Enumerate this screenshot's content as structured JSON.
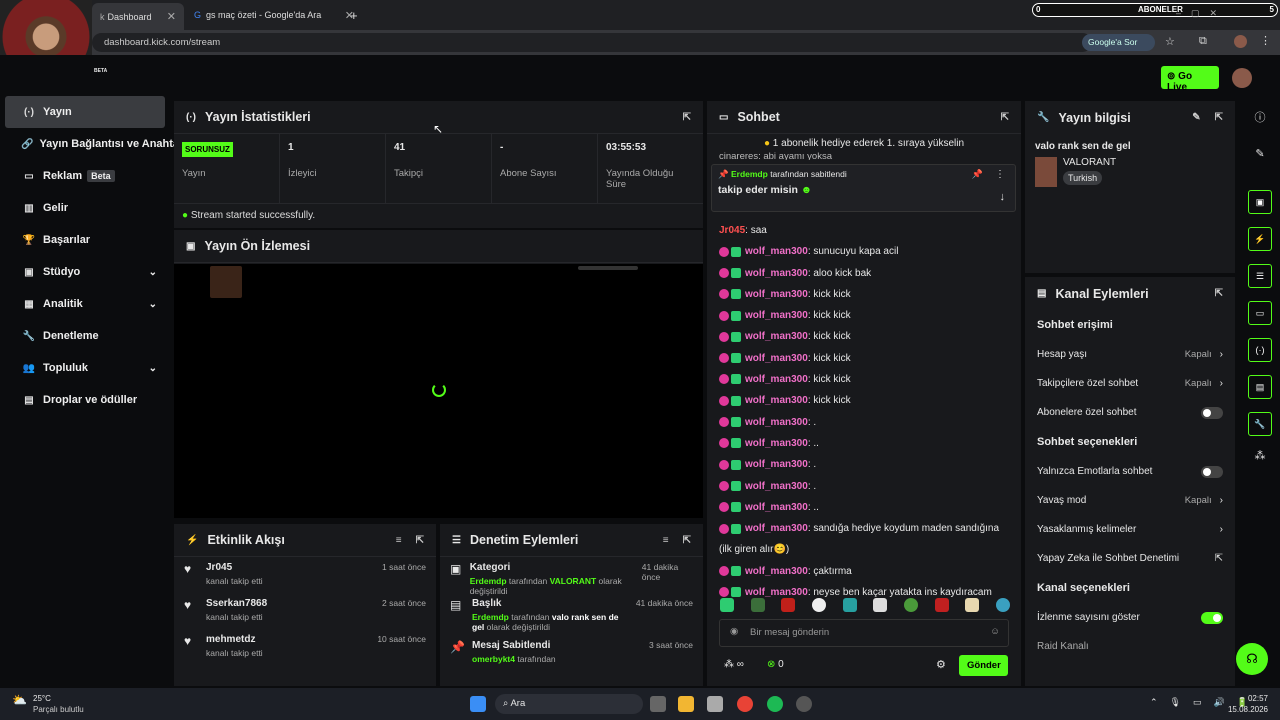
{
  "browser": {
    "tabs": [
      {
        "label": "Dashboard",
        "active": true
      },
      {
        "label": "gs maç özeti - Google'da Ara",
        "active": false
      }
    ],
    "new_tab": "+",
    "url": "dashboard.kick.com/stream",
    "google_ask": "Google'a Sor"
  },
  "overlay": {
    "subscriber_bar_left": "0",
    "subscriber_bar_label": "ABONELER",
    "subscriber_bar_right": "5",
    "beta_small": "BETA"
  },
  "header": {
    "go_live": "Go Live"
  },
  "sidebar": {
    "items": [
      {
        "label": "Yayın",
        "icon": "broadcast-icon",
        "active": true
      },
      {
        "label": "Yayın Bağlantısı ve Anahtar",
        "icon": "link-icon"
      },
      {
        "label": "Reklam",
        "icon": "ad-icon",
        "badge": "Beta"
      },
      {
        "label": "Gelir",
        "icon": "revenue-icon"
      },
      {
        "label": "Başarılar",
        "icon": "trophy-icon"
      },
      {
        "label": "Stüdyo",
        "icon": "studio-icon",
        "chevron": true
      },
      {
        "label": "Analitik",
        "icon": "analytics-icon",
        "chevron": true
      },
      {
        "label": "Denetleme",
        "icon": "wrench-icon"
      },
      {
        "label": "Topluluk",
        "icon": "community-icon",
        "chevron": true
      },
      {
        "label": "Droplar ve ödüller",
        "icon": "drops-icon"
      }
    ]
  },
  "stats_panel": {
    "title": "Yayın İstatistikleri",
    "stats": [
      {
        "value": "SORUNSUZ",
        "label": "Yayın"
      },
      {
        "value": "1",
        "label": "İzleyici"
      },
      {
        "value": "41",
        "label": "Takipçi"
      },
      {
        "value": "-",
        "label": "Abone Sayısı"
      },
      {
        "value": "03:55:53",
        "label": "Yayında Olduğu Süre"
      }
    ],
    "status": "Stream started successfully."
  },
  "preview_panel": {
    "title": "Yayın Ön İzlemesi"
  },
  "activity_panel": {
    "title": "Etkinlik Akışı",
    "items": [
      {
        "name": "Jr045",
        "sub": "kanalı takip etti",
        "time": "1 saat önce"
      },
      {
        "name": "Sserkan7868",
        "sub": "kanalı takip etti",
        "time": "2 saat önce"
      },
      {
        "name": "mehmetdz",
        "sub": "kanalı takip etti",
        "time": "10 saat önce"
      }
    ]
  },
  "moderation_panel": {
    "title": "Denetim Eylemleri",
    "items": [
      {
        "title": "Kategori",
        "who": "Erdemdp",
        "text_a": "tarafından",
        "value": "VALORANT",
        "text_b": "olarak değiştirildi",
        "time": "41 dakika önce"
      },
      {
        "title": "Başlık",
        "who": "Erdemdp",
        "text_a": "tarafından",
        "value": "valo rank sen de gel",
        "text_b": "olarak değiştirildi",
        "time": "41 dakika önce"
      },
      {
        "title": "Mesaj Sabitlendi",
        "who": "omerbykt4",
        "text_a": "tarafından",
        "value": "",
        "text_b": "",
        "time": "3 saat önce"
      }
    ]
  },
  "chat_panel": {
    "title": "Sohbet",
    "promo": "1 abonelik hediye ederek 1. sıraya yükselin",
    "partial_line": "cinareres: abi ayamı yoksa",
    "pinned_by": "Erdemdp",
    "pinned_label": "tarafından sabitlendi",
    "pinned_text": "takip eder misin",
    "messages": [
      {
        "user": "Jr045",
        "text": ": saa",
        "badges": false
      },
      {
        "user": "wolf_man300",
        "text": ": sunucuyu kapa acil",
        "badges": true
      },
      {
        "user": "wolf_man300",
        "text": ": aloo kick bak",
        "badges": true
      },
      {
        "user": "wolf_man300",
        "text": ": kick kick",
        "badges": true
      },
      {
        "user": "wolf_man300",
        "text": ": kick kick",
        "badges": true
      },
      {
        "user": "wolf_man300",
        "text": ": kick kick",
        "badges": true
      },
      {
        "user": "wolf_man300",
        "text": ": kick kick",
        "badges": true
      },
      {
        "user": "wolf_man300",
        "text": ": kick kick",
        "badges": true
      },
      {
        "user": "wolf_man300",
        "text": ": kick kick",
        "badges": true
      },
      {
        "user": "wolf_man300",
        "text": ": .",
        "badges": true
      },
      {
        "user": "wolf_man300",
        "text": ": ..",
        "badges": true
      },
      {
        "user": "wolf_man300",
        "text": ": .",
        "badges": true
      },
      {
        "user": "wolf_man300",
        "text": ": .",
        "badges": true
      },
      {
        "user": "wolf_man300",
        "text": ": ..",
        "badges": true
      },
      {
        "user": "wolf_man300",
        "text": ": sandığa hediye koydum maden sandığına",
        "badges": true
      },
      {
        "user": "",
        "text": "(ilk giren alır😊)",
        "badges": false
      },
      {
        "user": "wolf_man300",
        "text": ": çaktırma",
        "badges": true
      },
      {
        "user": "wolf_man300",
        "text": ": neyse ben kaçar yatakta ins kaydıracam",
        "badges": true
      }
    ],
    "input_placeholder": "Bir mesaj gönderin",
    "viewer_icon_text": "∞",
    "points": "0",
    "send": "Gönder"
  },
  "stream_info": {
    "title": "Yayın bilgisi",
    "stream_title": "valo rank sen de gel",
    "category": "VALORANT",
    "language": "Turkish"
  },
  "channel_actions": {
    "title": "Kanal Eylemleri",
    "chat_access": "Sohbet erişimi",
    "rows1": [
      {
        "label": "Hesap yaşı",
        "value": "Kapalı",
        "type": "chevron"
      },
      {
        "label": "Takipçilere özel sohbet",
        "value": "Kapalı",
        "type": "chevron"
      },
      {
        "label": "Abonelere özel sohbet",
        "value": "",
        "type": "toggle-off"
      }
    ],
    "chat_options": "Sohbet seçenekleri",
    "rows2": [
      {
        "label": "Yalnızca Emotlarla sohbet",
        "value": "",
        "type": "toggle-off"
      },
      {
        "label": "Yavaş mod",
        "value": "Kapalı",
        "type": "chevron"
      },
      {
        "label": "Yasaklanmış kelimeler",
        "value": "",
        "type": "chevron"
      },
      {
        "label": "Yapay Zeka ile Sohbet Denetimi",
        "value": "",
        "type": "external"
      }
    ],
    "channel_options": "Kanal seçenekleri",
    "rows3": [
      {
        "label": "İzlenme sayısını göster",
        "value": "",
        "type": "toggle-on"
      },
      {
        "label": "Raid Kanalı",
        "value": "",
        "type": "none"
      }
    ]
  },
  "taskbar": {
    "weather_temp": "25°C",
    "weather_desc": "Parçalı bulutlu",
    "search": "Ara",
    "time": "02:57",
    "date": "15.08.2026"
  },
  "colors": {
    "accent": "#53fc18",
    "username": "#f070c8"
  }
}
